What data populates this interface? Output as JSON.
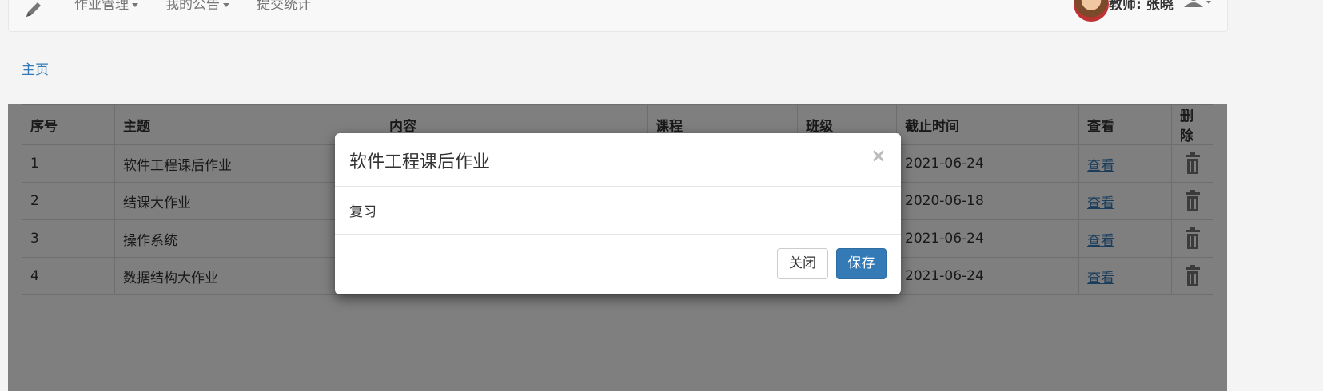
{
  "navbar": {
    "items": [
      {
        "label": "作业管理",
        "dropdown": true
      },
      {
        "label": "我的公告",
        "dropdown": true
      },
      {
        "label": "提交统计",
        "dropdown": false
      }
    ],
    "user_label": "教师: 张晓"
  },
  "breadcrumb": "主页",
  "table": {
    "headers": [
      "序号",
      "主题",
      "内容",
      "课程",
      "班级",
      "截止时间",
      "查看",
      "删除"
    ],
    "rows": [
      {
        "index": "1",
        "title": "软件工程课后作业",
        "deadline": "2021-06-24",
        "view": "查看"
      },
      {
        "index": "2",
        "title": "结课大作业",
        "deadline": "2020-06-18",
        "view": "查看"
      },
      {
        "index": "3",
        "title": "操作系统",
        "deadline": "2021-06-24",
        "view": "查看"
      },
      {
        "index": "4",
        "title": "数据结构大作业",
        "deadline": "2021-06-24",
        "view": "查看"
      }
    ]
  },
  "modal": {
    "title": "软件工程课后作业",
    "content": "复习",
    "close_symbol": "×",
    "close_label": "关闭",
    "save_label": "保存"
  },
  "colors": {
    "primary": "#337ab7",
    "backdrop": "rgba(0,0,0,0.5)"
  }
}
